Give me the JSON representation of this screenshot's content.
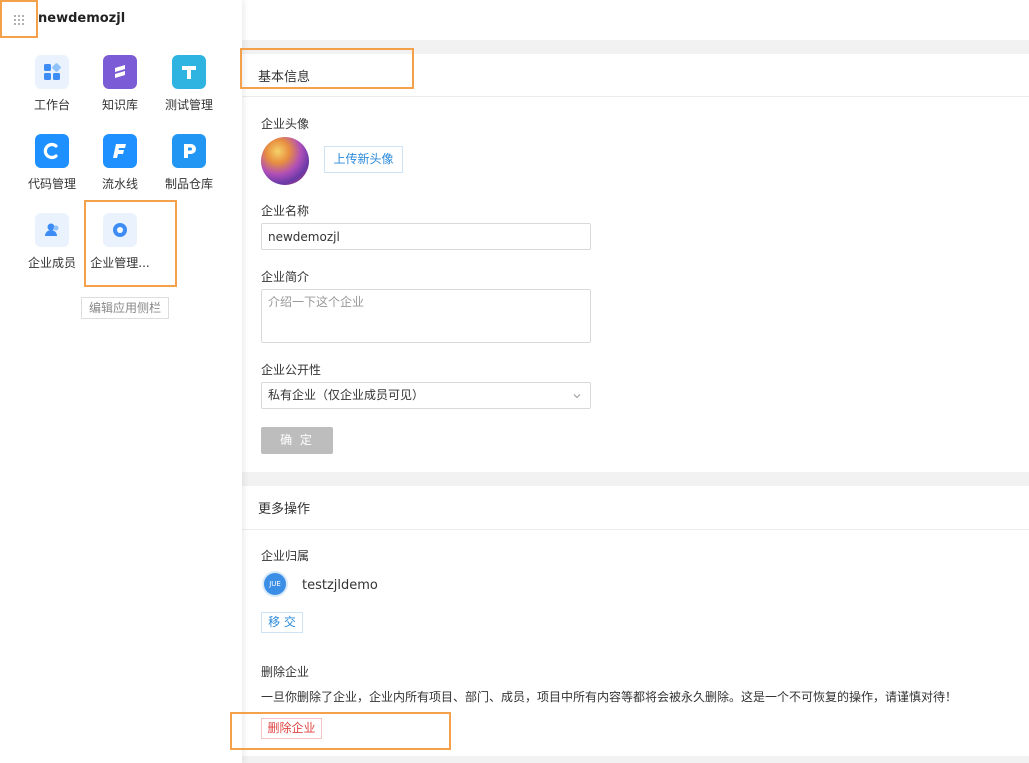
{
  "sidebar": {
    "org_name": "newdemozjl",
    "apps": [
      {
        "label": "工作台",
        "icon": "dashboard-icon",
        "color": "#e8f2fd"
      },
      {
        "label": "知识库",
        "icon": "wiki-icon",
        "color": "#7c5cd6"
      },
      {
        "label": "测试管理",
        "icon": "testhub-icon",
        "color": "#2fb3e0"
      },
      {
        "label": "代码管理",
        "icon": "code-icon",
        "color": "#1e90ff"
      },
      {
        "label": "流水线",
        "icon": "flow-icon",
        "color": "#1e90ff"
      },
      {
        "label": "制品仓库",
        "icon": "package-icon",
        "color": "#2196f3"
      },
      {
        "label": "企业成员",
        "icon": "member-icon",
        "color": "#e8f2fd"
      },
      {
        "label": "企业管理...",
        "icon": "enterprise-icon",
        "color": "#e8f2fd"
      }
    ],
    "edit_label": "编辑应用侧栏"
  },
  "basic": {
    "title": "基本信息",
    "avatar_label": "企业头像",
    "upload_label": "上传新头像",
    "name_label": "企业名称",
    "name_value": "newdemozjl",
    "intro_label": "企业简介",
    "intro_placeholder": "介绍一下这个企业",
    "public_label": "企业公开性",
    "public_value": "私有企业（仅企业成员可见）",
    "confirm_label": "确 定"
  },
  "more": {
    "title": "更多操作",
    "owner_label": "企业归属",
    "owner_avatar_text": "JUE",
    "owner_name": "testzjldemo",
    "transfer_label": "移 交",
    "delete_title": "删除企业",
    "delete_warning": "一旦你删除了企业，企业内所有项目、部门、成员，项目中所有内容等都将会被永久删除。这是一个不可恢复的操作，请谨慎对待！",
    "delete_button": "删除企业"
  }
}
